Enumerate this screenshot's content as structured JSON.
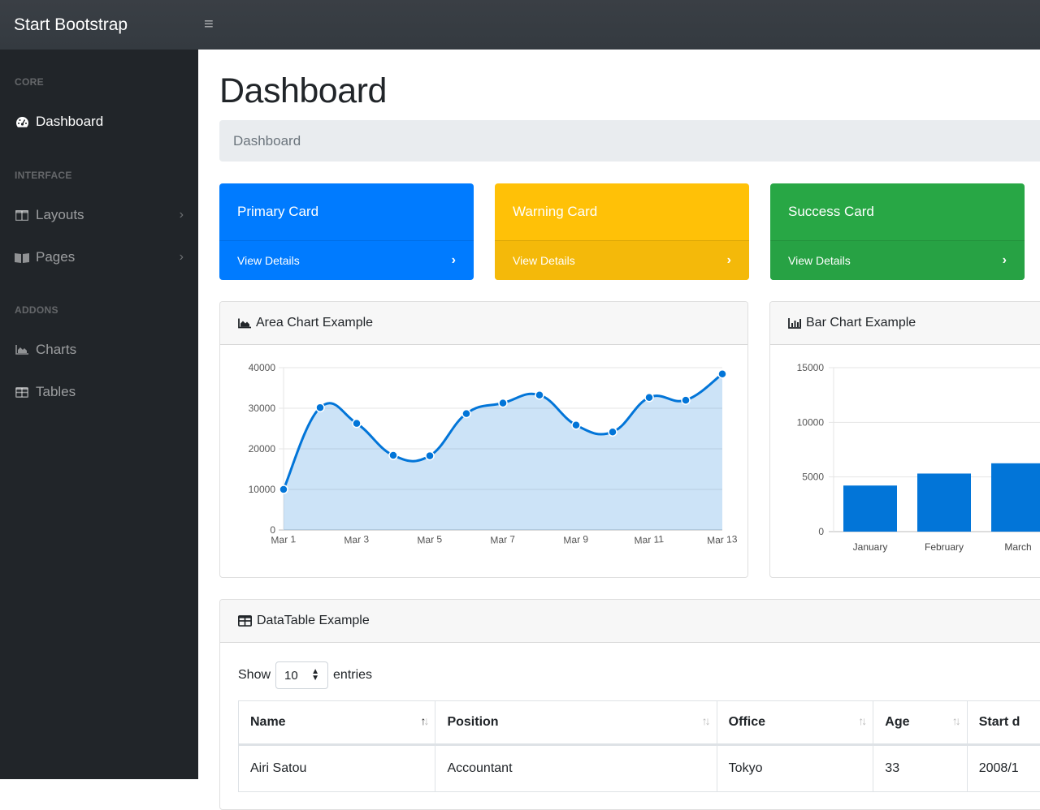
{
  "topnav": {
    "brand": "Start Bootstrap",
    "toggle_icon": "hamburger-icon"
  },
  "sidebar": {
    "headings": [
      "CORE",
      "INTERFACE",
      "ADDONS"
    ],
    "items": [
      {
        "label": "Dashboard",
        "icon": "tachometer-icon",
        "active": true
      },
      {
        "label": "Layouts",
        "icon": "columns-icon",
        "expandable": true
      },
      {
        "label": "Pages",
        "icon": "book-open-icon",
        "expandable": true
      },
      {
        "label": "Charts",
        "icon": "area-chart-icon"
      },
      {
        "label": "Tables",
        "icon": "table-icon"
      }
    ]
  },
  "page": {
    "title": "Dashboard",
    "breadcrumb": "Dashboard"
  },
  "stat_cards": [
    {
      "title": "Primary Card",
      "link": "View Details",
      "color": "#007bff"
    },
    {
      "title": "Warning Card",
      "link": "View Details",
      "color": "#ffc107"
    },
    {
      "title": "Success Card",
      "link": "View Details",
      "color": "#28a745"
    }
  ],
  "area_card": {
    "title": "Area Chart Example"
  },
  "bar_card": {
    "title": "Bar Chart Example"
  },
  "chart_data": [
    {
      "type": "area",
      "title": "Area Chart Example",
      "x": [
        "Mar 1",
        "Mar 2",
        "Mar 3",
        "Mar 4",
        "Mar 5",
        "Mar 6",
        "Mar 7",
        "Mar 8",
        "Mar 9",
        "Mar 10",
        "Mar 11",
        "Mar 12",
        "Mar 13"
      ],
      "xtick_labels": [
        "Mar 1",
        "Mar 3",
        "Mar 5",
        "Mar 7",
        "Mar 9",
        "Mar 11",
        "Mar 13"
      ],
      "values": [
        10000,
        30162,
        26263,
        18394,
        18287,
        28682,
        31274,
        33259,
        25849,
        24159,
        32651,
        31984,
        38451
      ],
      "ylim": [
        0,
        40000
      ],
      "yticks": [
        0,
        10000,
        20000,
        30000,
        40000
      ],
      "grid": true,
      "color": "#0275d8",
      "fill": "rgba(2,117,216,0.2)"
    },
    {
      "type": "bar",
      "title": "Bar Chart Example",
      "categories": [
        "January",
        "February",
        "March"
      ],
      "values": [
        4215,
        5312,
        6251
      ],
      "ylim": [
        0,
        15000
      ],
      "yticks": [
        0,
        5000,
        10000,
        15000
      ],
      "grid": true,
      "color": "#0275d8"
    }
  ],
  "datatable": {
    "title": "DataTable Example",
    "length_prefix": "Show",
    "length_value": "10",
    "length_suffix": "entries",
    "columns": [
      "Name",
      "Position",
      "Office",
      "Age",
      "Start d"
    ],
    "rows": [
      [
        "Airi Satou",
        "Accountant",
        "Tokyo",
        "33",
        "2008/1"
      ]
    ]
  }
}
